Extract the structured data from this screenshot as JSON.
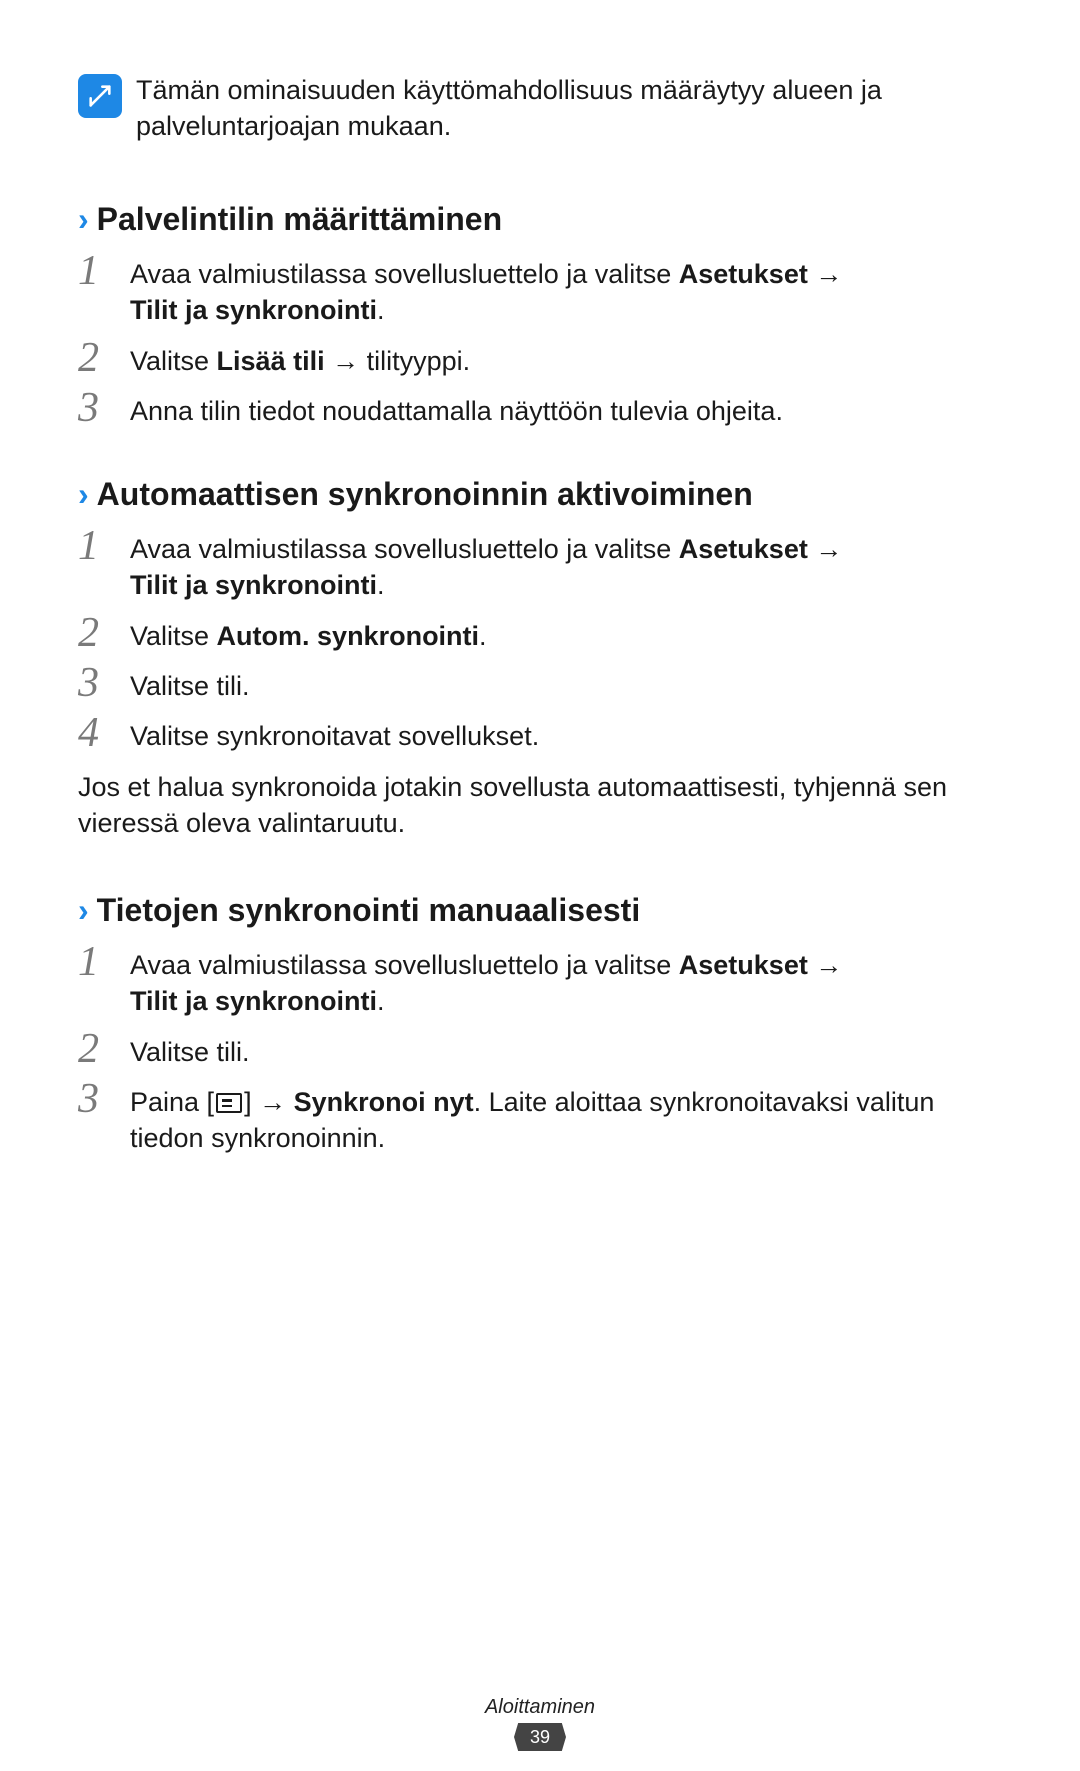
{
  "note": {
    "text": "Tämän ominaisuuden käyttömahdollisuus määräytyy alueen ja palveluntarjoajan mukaan."
  },
  "sections": {
    "s1": {
      "title": "Palvelintilin määrittäminen",
      "step1_a": "Avaa valmiustilassa sovellusluettelo ja valitse ",
      "step1_b": "Asetukset",
      "step1_arrow": " → ",
      "step1_c": "Tilit ja synkronointi",
      "step1_d": ".",
      "step2_a": "Valitse ",
      "step2_b": "Lisää tili",
      "step2_arrow": " → ",
      "step2_c": "tilityyppi.",
      "step3": "Anna tilin tiedot noudattamalla näyttöön tulevia ohjeita."
    },
    "s2": {
      "title": "Automaattisen synkronoinnin aktivoiminen",
      "step1_a": "Avaa valmiustilassa sovellusluettelo ja valitse ",
      "step1_b": "Asetukset",
      "step1_arrow": " → ",
      "step1_c": "Tilit ja synkronointi",
      "step1_d": ".",
      "step2_a": "Valitse ",
      "step2_b": "Autom. synkronointi",
      "step2_c": ".",
      "step3": "Valitse tili.",
      "step4": "Valitse synkronoitavat sovellukset.",
      "after": "Jos et halua synkronoida jotakin sovellusta automaattisesti, tyhjennä sen vieressä oleva valintaruutu."
    },
    "s3": {
      "title": "Tietojen synkronointi manuaalisesti",
      "step1_a": "Avaa valmiustilassa sovellusluettelo ja valitse ",
      "step1_b": "Asetukset",
      "step1_arrow": " → ",
      "step1_c": "Tilit ja synkronointi",
      "step1_d": ".",
      "step2": "Valitse tili.",
      "step3_a": "Paina [",
      "step3_b": "] → ",
      "step3_c": "Synkronoi nyt",
      "step3_d": ". Laite aloittaa synkronoitavaksi valitun tiedon synkronoinnin."
    }
  },
  "nums": {
    "n1": "1",
    "n2": "2",
    "n3": "3",
    "n4": "4"
  },
  "footer": "Aloittaminen",
  "page": "39"
}
